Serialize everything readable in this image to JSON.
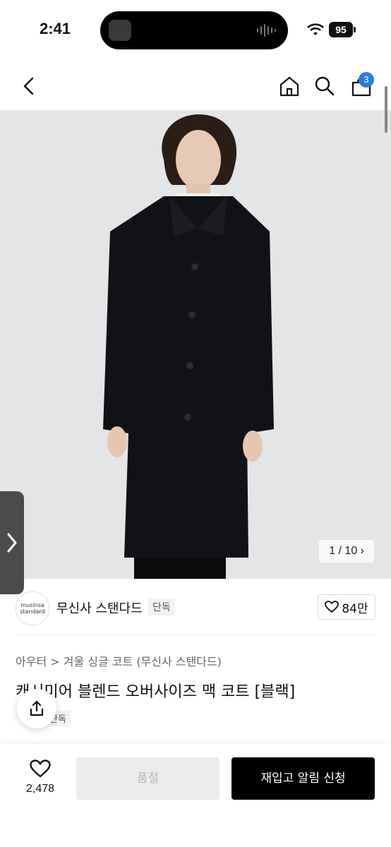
{
  "status": {
    "time": "2:41",
    "battery": "95"
  },
  "nav": {
    "cart_count": "3"
  },
  "gallery": {
    "counter": "1 / 10 ›"
  },
  "brand": {
    "logo_line1": "musinsa",
    "logo_line2": "standard",
    "name": "무신사 스탠다드",
    "tag": "단독",
    "likes": "84만"
  },
  "product": {
    "breadcrumb": "아우터 > 겨울 싱글 코트 (무신사 스탠다드)",
    "title": "캐시미어 블렌드 오버사이즈 맥 코트 [블랙]",
    "badge": "단독"
  },
  "bottom": {
    "wish_count": "2,478",
    "soldout_label": "품절",
    "restock_label": "재입고 알림 신청"
  },
  "colors": {
    "accent_badge": "#2a7de1",
    "primary_button": "#000000"
  }
}
